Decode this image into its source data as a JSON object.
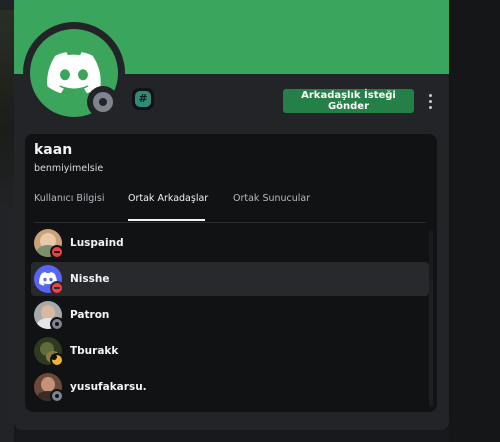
{
  "profile": {
    "username": "kaan",
    "handle": "benmiyimelsie",
    "status": "offline",
    "banner_color": "#3aa55d",
    "avatar_icon": "discord-logo-icon",
    "badge_icon": "hash-badge-icon"
  },
  "actions": {
    "add_friend_label": "Arkadaşlık İsteği Gönder",
    "more_icon": "more-vertical-icon"
  },
  "tabs": [
    {
      "label": "Kullanıcı Bilgisi",
      "active": false
    },
    {
      "label": "Ortak Arkadaşlar",
      "active": true
    },
    {
      "label": "Ortak Sunucular",
      "active": false
    }
  ],
  "mutual_friends": [
    {
      "name": "Luspaind",
      "status": "dnd"
    },
    {
      "name": "Nisshe",
      "status": "dnd"
    },
    {
      "name": "Patron",
      "status": "offline"
    },
    {
      "name": "Tburakk",
      "status": "idle"
    },
    {
      "name": "yusufakarsu.",
      "status": "offline"
    }
  ],
  "colors": {
    "accent_green": "#248046",
    "dnd": "#f23f43",
    "idle": "#f0b232",
    "offline": "#80848e"
  }
}
